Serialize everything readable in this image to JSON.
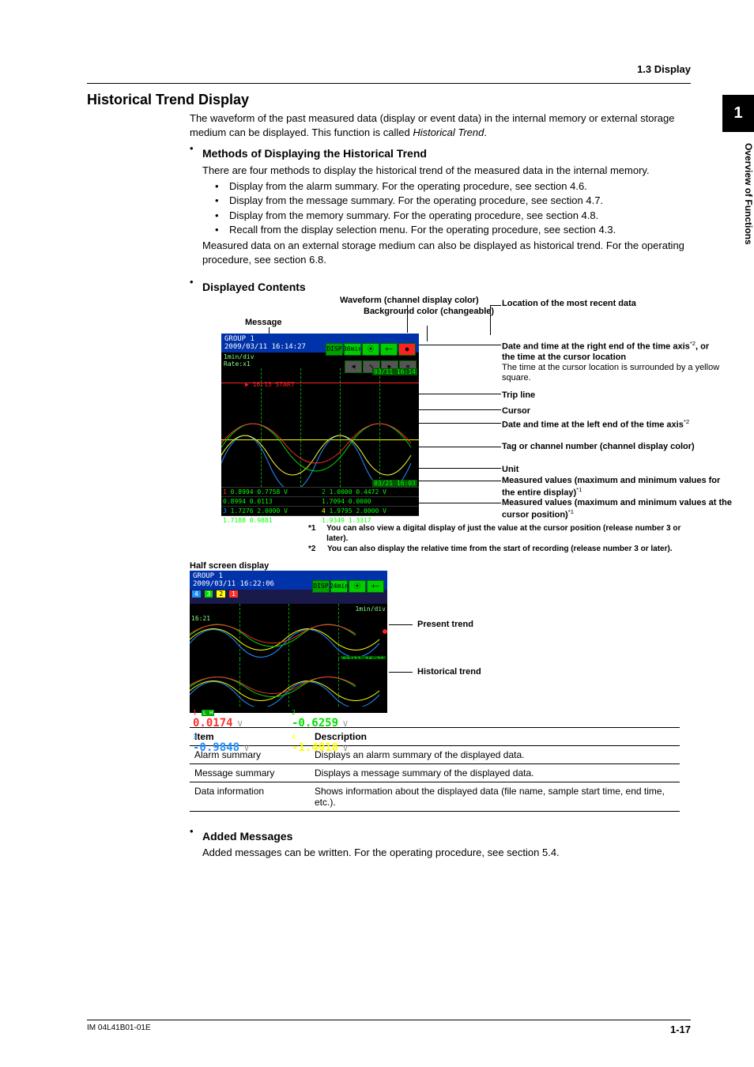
{
  "header": {
    "section": "1.3  Display"
  },
  "sidetab": {
    "chapter": "1",
    "label": "Overview of Functions"
  },
  "h1": "Historical Trend Display",
  "intro1": "The waveform of the past measured data (display or event data) in the internal memory or external storage medium can be displayed. This function is called ",
  "intro1_em": "Historical Trend",
  "intro1_end": ".",
  "methods_heading": "Methods of Displaying the Historical Trend",
  "methods_intro": "There are four methods to display the historical trend of the measured data in the internal memory.",
  "methods_items": [
    "Display from the alarm summary. For the operating procedure, see section 4.6.",
    "Display from the message summary. For the operating procedure, see section 4.7.",
    "Display from the memory summary. For the operating procedure, see section 4.8.",
    "Recall from the display selection menu. For the operating procedure, see section 4.3."
  ],
  "methods_tail": "Measured data on an external storage medium can also be displayed as historical trend. For the operating procedure, see section 6.8.",
  "displayed_heading": "Displayed Contents",
  "diagram_labels": {
    "waveform": "Waveform (channel display color)",
    "background": "Background color (changeable)",
    "message": "Message",
    "location": "Location of the most recent data",
    "dt_right_a": "Date and time at the right end of the time axis",
    "dt_right_b": ", or the time at the cursor location",
    "dt_right_c": "The time at the cursor location is surrounded by a yellow square.",
    "trip": "Trip line",
    "cursor": "Cursor",
    "dt_left": "Date and time at the left end of the time axis",
    "tag": "Tag or channel number (channel display color)",
    "unit": "Unit",
    "mv_entire": "Measured values (maximum and minimum values for the entire display)",
    "mv_cursor": "Measured values (maximum and minimum values at the cursor position)"
  },
  "screenshot1": {
    "group": "GROUP 1",
    "datetime": "2009/03/11 16:14:27",
    "disp": "DISP",
    "timediv": "30min",
    "rate1": "1min/div",
    "rate2": "Rate:x1",
    "start_msg": "16:13 START",
    "right_ts": "03/11 16:14",
    "left_ts": "03/21 16:03",
    "rows": [
      {
        "a": "1",
        "b": "0.8994  0.7758",
        "c": "V",
        "d": "2",
        "e": "1.0000  0.4472",
        "f": "V"
      },
      {
        "a": "",
        "b": "0.8994  0.0113",
        "c": "",
        "d": "",
        "e": "1.7094  0.0000",
        "f": ""
      },
      {
        "a": "3",
        "b": "1.7276  2.0000",
        "c": "V",
        "d": "4",
        "e": "1.9795  2.0000",
        "f": "V"
      },
      {
        "a": "",
        "b": "1.7188  0.9881",
        "c": "",
        "d": "",
        "e": "1.9349  1.3317",
        "f": ""
      }
    ]
  },
  "footnotes": {
    "f1": "You can also view a digital display of just the value at the cursor position (release number 3 or later).",
    "f2": "You can also display the relative time from the start of recording (release number 3 or later)."
  },
  "half_label": "Half screen display",
  "screenshot2": {
    "group": "GROUP 1",
    "datetime": "2009/03/11 16:22:06",
    "disp": "DISP",
    "timediv": "24min",
    "rate": "1min/div",
    "ts_upper": "16:21",
    "ts_right": "03/11 16:21",
    "present": "Present trend",
    "historical": "Historical trend",
    "vals": [
      {
        "n": "1",
        "v": "0.0174",
        "u": "V",
        "color": "#ff3030"
      },
      {
        "n": "2",
        "v": "-0.6259",
        "u": "V",
        "color": "#00e000"
      },
      {
        "n": "3",
        "v": "-0.9848",
        "u": "V",
        "color": "#1e90ff"
      },
      {
        "n": "4",
        "v": "-1.4018",
        "u": "V",
        "color": "#ffff00"
      }
    ]
  },
  "table": {
    "h1": "Item",
    "h2": "Description",
    "rows": [
      {
        "item": "Alarm summary",
        "desc": "Displays an alarm summary of the displayed data."
      },
      {
        "item": "Message summary",
        "desc": "Displays a message summary of the displayed data."
      },
      {
        "item": "Data information",
        "desc": "Shows information about the displayed data (file name, sample start time, end time, etc.)."
      }
    ]
  },
  "added_heading": "Added Messages",
  "added_body": "Added messages can be written. For the operating procedure, see section 5.4.",
  "footer": {
    "left": "IM 04L41B01-01E",
    "right": "1-17"
  }
}
